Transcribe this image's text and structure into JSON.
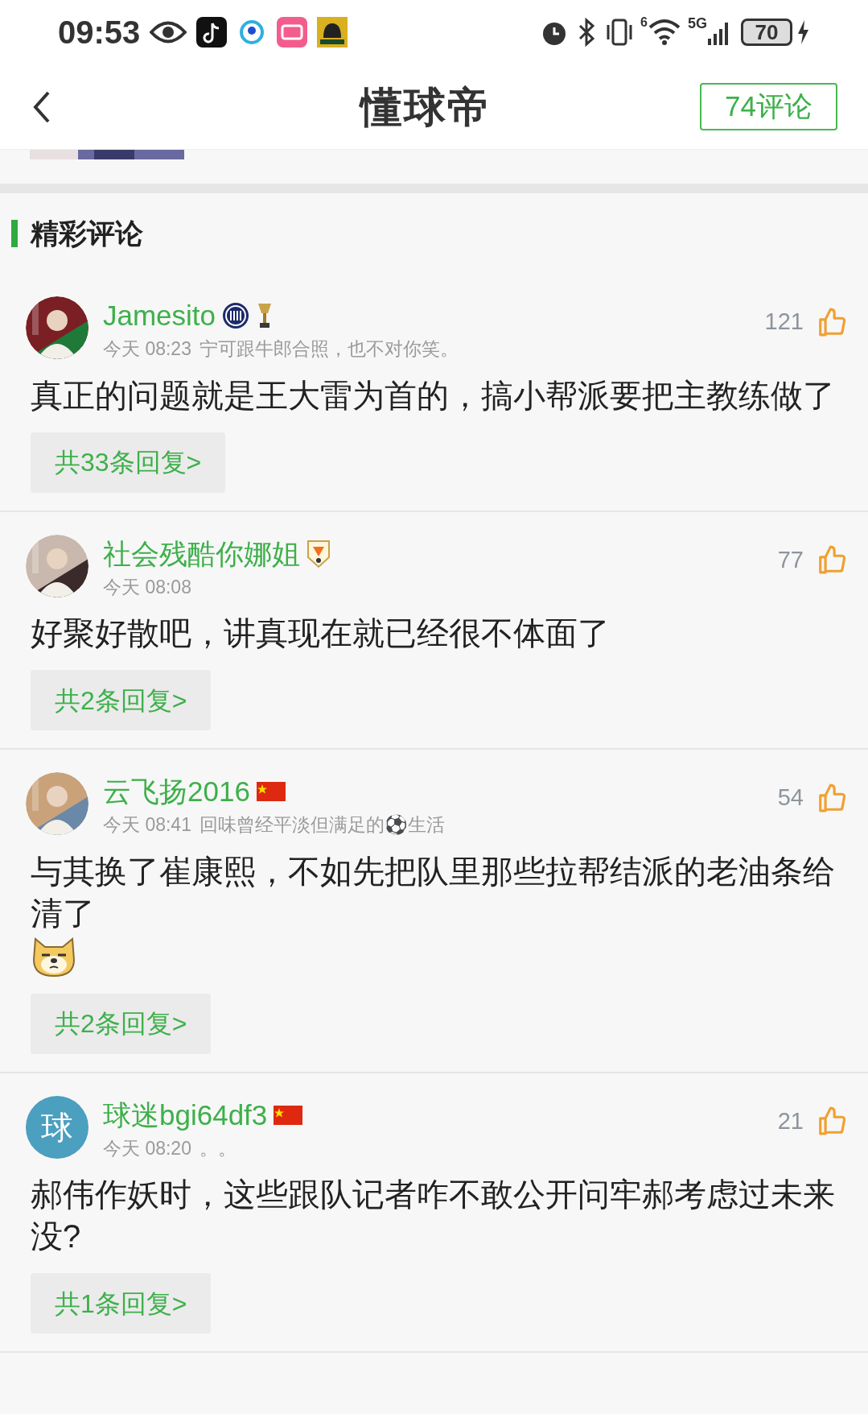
{
  "status_bar": {
    "time": "09:53",
    "battery": "70",
    "network": "5G",
    "wifi_tag": "6"
  },
  "header": {
    "title": "懂球帝",
    "comments_button": "74评论"
  },
  "section_title": "精彩评论",
  "comments": [
    {
      "avatar": {
        "kind": "picture"
      },
      "name": "Jamesito",
      "badges": [
        {
          "kind": "crest"
        },
        {
          "kind": "trophy"
        }
      ],
      "time": "今天 08:23",
      "signature": "宁可跟牛郎合照，也不对你笑。",
      "likes": "121",
      "body": "真正的问题就是王大雷为首的，搞小帮派要把主教练做了",
      "sticker": false,
      "replies": "共33条回复>"
    },
    {
      "avatar": {
        "kind": "picture"
      },
      "name": "社会残酷你娜姐",
      "badges": [
        {
          "kind": "shield"
        }
      ],
      "time": "今天 08:08",
      "likes": "77",
      "body": "好聚好散吧，讲真现在就已经很不体面了",
      "sticker": false,
      "replies": "共2条回复>"
    },
    {
      "avatar": {
        "kind": "picture"
      },
      "name": "云飞扬2016",
      "badges": [
        {
          "kind": "flag"
        }
      ],
      "time": "今天 08:41",
      "signature": "回味曾经平淡但满足的⚽生活",
      "likes": "54",
      "body": "与其换了崔康熙，不如先把队里那些拉帮结派的老油条给清了",
      "sticker": true,
      "replies": "共2条回复>"
    },
    {
      "avatar": {
        "kind": "letter",
        "text": "球"
      },
      "name": "球迷bgi64df3",
      "badges": [
        {
          "kind": "flag"
        }
      ],
      "time": "今天 08:20",
      "signature": "。。",
      "likes": "21",
      "body": "郝伟作妖时，这些跟队记者咋不敢公开问牢郝考虑过未来没?",
      "sticker": false,
      "replies": "共1条回复>"
    }
  ]
}
